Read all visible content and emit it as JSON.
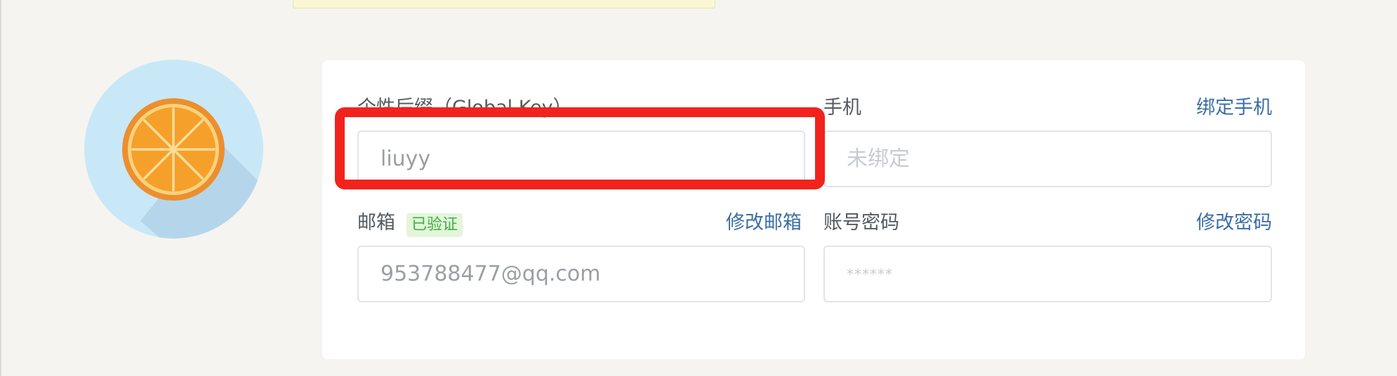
{
  "profile": {
    "avatar_icon": "orange-slice-icon"
  },
  "global_key": {
    "label": "个性后缀（Global Key）",
    "value": "liuyy"
  },
  "phone": {
    "label": "手机",
    "link": "绑定手机",
    "placeholder": "未绑定"
  },
  "email": {
    "label": "邮箱",
    "badge": "已验证",
    "link": "修改邮箱",
    "value": "953788477@qq.com"
  },
  "password": {
    "label": "账号密码",
    "link": "修改密码",
    "placeholder": "******"
  },
  "colors": {
    "highlight": "#f2231c",
    "link": "#3a6ea5",
    "badge_text": "#3fae45",
    "badge_bg": "#e3f6db",
    "avatar_bg": "#c9e8f7",
    "orange": "#f5a02a"
  }
}
